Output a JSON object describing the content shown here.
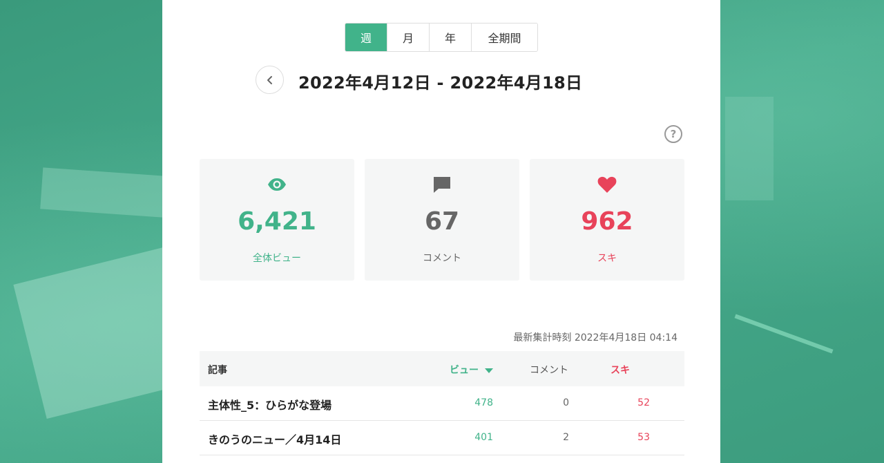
{
  "colors": {
    "accent": "#41b38a",
    "like": "#e8435a",
    "neutral": "#666666",
    "background": "#3f9e80"
  },
  "period_tabs": [
    {
      "label": "週",
      "active": true
    },
    {
      "label": "月",
      "active": false
    },
    {
      "label": "年",
      "active": false
    },
    {
      "label": "全期間",
      "active": false
    }
  ],
  "date_range": "2022年4月12日 - 2022年4月18日",
  "help_icon": "?",
  "stats": {
    "views": {
      "value": "6,421",
      "label": "全体ビュー",
      "icon": "eye-icon"
    },
    "comments": {
      "value": "67",
      "label": "コメント",
      "icon": "speech-bubble-icon"
    },
    "likes": {
      "value": "962",
      "label": "スキ",
      "icon": "heart-icon"
    }
  },
  "last_updated": "最新集計時刻 2022年4月18日 04:14",
  "table": {
    "headers": {
      "article": "記事",
      "views": "ビュー",
      "comments": "コメント",
      "likes": "スキ"
    },
    "rows": [
      {
        "title": "主体性_5：ひらがな登場",
        "views": "478",
        "comments": "0",
        "likes": "52"
      },
      {
        "title": "きのうのニュー／4月14日",
        "views": "401",
        "comments": "2",
        "likes": "53"
      }
    ]
  }
}
